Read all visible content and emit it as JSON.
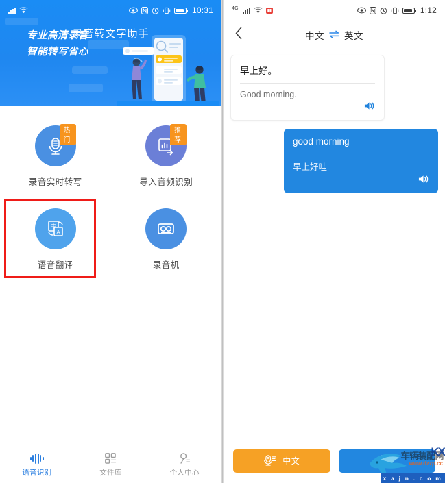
{
  "left_phone": {
    "status_bar": {
      "signal_icon": "signal-bars-icon",
      "wifi_icon": "wifi-icon",
      "eye_icon": "eye-icon",
      "nfc_icon": "nfc-icon",
      "alarm_icon": "alarm-clock-icon",
      "vibrate_icon": "vibrate-icon",
      "battery_icon": "battery-icon",
      "time": "10:31"
    },
    "hero": {
      "title": "录音转文字助手",
      "slogan_line1": "专业高清录音",
      "slogan_line2": "智能转写省心",
      "background_color": "#1a8cf5",
      "illustration": "people-with-phone-illustration"
    },
    "features": [
      {
        "label": "录音实时转写",
        "badge": "热门",
        "icon": "microphone-document-icon",
        "circle_color": "#4a90e2",
        "selected": false
      },
      {
        "label": "导入音频识别",
        "badge": "推荐",
        "icon": "audio-import-chart-icon",
        "circle_color": "#6b7fd7",
        "selected": false
      },
      {
        "label": "语音翻译",
        "badge": "",
        "icon": "translate-icon",
        "circle_color": "#4fa3ec",
        "selected": true
      },
      {
        "label": "录音机",
        "badge": "",
        "icon": "cassette-recorder-icon",
        "circle_color": "#4a90e2",
        "selected": false
      }
    ],
    "highlight_color": "#ef1c18",
    "tabbar": [
      {
        "label": "语音识别",
        "icon": "waveform-icon",
        "active": true
      },
      {
        "label": "文件库",
        "icon": "grid-list-icon",
        "active": false
      },
      {
        "label": "个人中心",
        "icon": "person-icon",
        "active": false
      }
    ]
  },
  "right_phone": {
    "status_bar": {
      "network_label": "4G",
      "signal_icon": "signal-bars-icon",
      "wifi_icon": "wifi-icon",
      "sim_badge_icon": "red-sim-badge-icon",
      "eye_icon": "eye-icon",
      "nfc_icon": "nfc-icon",
      "alarm_icon": "alarm-clock-icon",
      "vibrate_icon": "vibrate-icon",
      "battery_icon": "battery-icon",
      "time": "1:12"
    },
    "header": {
      "back_icon": "back-chevron-icon",
      "source_language": "中文",
      "swap_icon": "swap-arrows-icon",
      "target_language": "英文"
    },
    "messages": [
      {
        "side": "left",
        "source_text": "早上好。",
        "translated_text": "Good morning.",
        "speaker_icon": "speaker-icon"
      },
      {
        "side": "right",
        "source_text": "good morning",
        "translated_text": "早上好哇",
        "speaker_icon": "speaker-icon"
      }
    ],
    "footer": {
      "primary_button": {
        "label": "中文",
        "icon": "microphone-text-icon",
        "color": "#f6a125"
      },
      "secondary_button": {
        "label": "",
        "icon": "microphone-text-icon",
        "color": "#2287e0"
      }
    },
    "watermark": {
      "logo": "shark-logo",
      "text": "车辆装配网",
      "url": "www.dzzp.cc",
      "site": "x a j n . c o m",
      "mark": "KX"
    }
  }
}
